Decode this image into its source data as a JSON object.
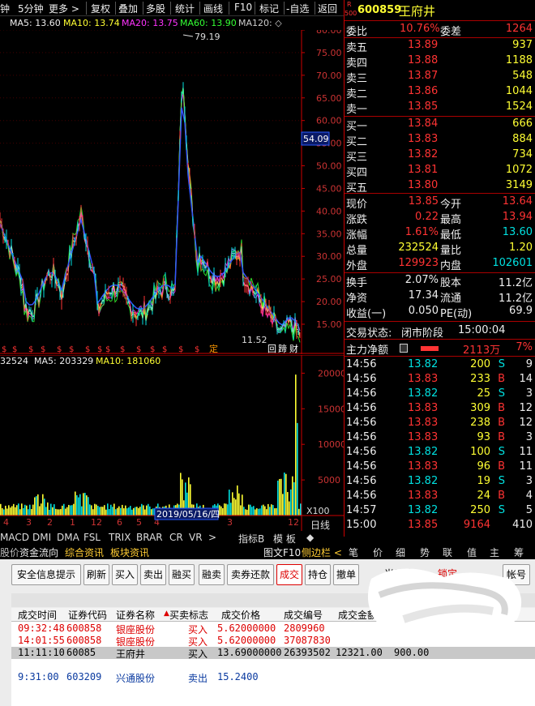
{
  "toolbar": {
    "period_left": "钟",
    "period": "5分钟",
    "more": "更多 >",
    "items": [
      "复权",
      "叠加",
      "多股",
      "统计",
      "画线",
      "F10",
      "标记",
      "-自选",
      "返回"
    ]
  },
  "ma_bar": {
    "ma5": "MA5: 13.60",
    "ma10": "MA10: 13.74",
    "ma20": "MA20: 13.75",
    "ma60": "MA60: 13.90",
    "ma120": "MA120: ◇"
  },
  "price_chart": {
    "y_ticks": [
      "80.00",
      "75.00",
      "70.00",
      "65.00",
      "60.00",
      "55.00",
      "50.00",
      "45.00",
      "40.00",
      "35.00",
      "30.00",
      "25.00",
      "20.00",
      "15.00"
    ],
    "current_tag": "54.09",
    "max_label": "79.19",
    "min_label": "11.52",
    "event_labels": [
      "定",
      "回",
      "蹄",
      "财"
    ]
  },
  "vol_bar": {
    "vol": "32524",
    "ma5": "MA5: 203329",
    "ma10": "MA10: 181060"
  },
  "vol_chart": {
    "y_ticks": [
      "20000",
      "15000",
      "10000",
      "5000"
    ],
    "unit": "X100",
    "date": "2019/05/16/四",
    "period": "日线",
    "x_ticks": [
      "4",
      "3",
      "2",
      "1",
      "12",
      "6",
      "5",
      "4",
      "3",
      "12"
    ]
  },
  "stock": {
    "code": "600859",
    "name": "王府井",
    "badge_r": "R",
    "badge_500": "500",
    "weibi_label": "委比",
    "weibi": "10.76%",
    "weicha_label": "委差",
    "weicha": "1264",
    "asks": [
      {
        "label": "卖五",
        "price": "13.89",
        "vol": "937"
      },
      {
        "label": "卖四",
        "price": "13.88",
        "vol": "1188"
      },
      {
        "label": "卖三",
        "price": "13.87",
        "vol": "548"
      },
      {
        "label": "卖二",
        "price": "13.86",
        "vol": "1044"
      },
      {
        "label": "卖一",
        "price": "13.85",
        "vol": "1524"
      }
    ],
    "bids": [
      {
        "label": "买一",
        "price": "13.84",
        "vol": "666"
      },
      {
        "label": "买二",
        "price": "13.83",
        "vol": "884"
      },
      {
        "label": "买三",
        "price": "13.82",
        "vol": "734"
      },
      {
        "label": "买四",
        "price": "13.81",
        "vol": "1072"
      },
      {
        "label": "买五",
        "price": "13.80",
        "vol": "3149"
      }
    ],
    "stats": [
      {
        "l1": "现价",
        "v1": "13.85",
        "l2": "今开",
        "v2": "13.64"
      },
      {
        "l1": "涨跌",
        "v1": "0.22",
        "l2": "最高",
        "v2": "13.94"
      },
      {
        "l1": "涨幅",
        "v1": "1.61%",
        "l2": "最低",
        "v2": "13.60"
      },
      {
        "l1": "总量",
        "v1": "232524",
        "l2": "量比",
        "v2": "1.20"
      },
      {
        "l1": "外盘",
        "v1": "129923",
        "l2": "内盘",
        "v2": "102601"
      }
    ],
    "stats2": [
      {
        "l1": "换手",
        "v1": "2.07%",
        "l2": "股本",
        "v2": "11.2亿"
      },
      {
        "l1": "净资",
        "v1": "17.34",
        "l2": "流通",
        "v2": "11.2亿"
      },
      {
        "l1": "收益(一)",
        "v1": "0.050",
        "l2": "PE(动)",
        "v2": "69.9"
      }
    ],
    "status_label": "交易状态:",
    "status_value": "闭市阶段",
    "status_time": "15:00:04",
    "main_flow_label": "主力净额",
    "main_flow_value": "2113万",
    "main_flow_pct": "7%"
  },
  "ticks": [
    {
      "t": "14:56",
      "p": "13.82",
      "v": "200",
      "d": "S",
      "n": "9"
    },
    {
      "t": "14:56",
      "p": "13.83",
      "v": "233",
      "d": "B",
      "n": "14"
    },
    {
      "t": "14:56",
      "p": "13.82",
      "v": "25",
      "d": "S",
      "n": "3"
    },
    {
      "t": "14:56",
      "p": "13.83",
      "v": "309",
      "d": "B",
      "n": "12"
    },
    {
      "t": "14:56",
      "p": "13.83",
      "v": "238",
      "d": "B",
      "n": "12"
    },
    {
      "t": "14:56",
      "p": "13.83",
      "v": "93",
      "d": "B",
      "n": "3"
    },
    {
      "t": "14:56",
      "p": "13.82",
      "v": "100",
      "d": "S",
      "n": "11"
    },
    {
      "t": "14:56",
      "p": "13.83",
      "v": "96",
      "d": "B",
      "n": "11"
    },
    {
      "t": "14:56",
      "p": "13.82",
      "v": "19",
      "d": "S",
      "n": "3"
    },
    {
      "t": "14:56",
      "p": "13.83",
      "v": "24",
      "d": "B",
      "n": "4"
    },
    {
      "t": "14:57",
      "p": "13.82",
      "v": "250",
      "d": "S",
      "n": "5"
    },
    {
      "t": "15:00",
      "p": "13.85",
      "v": "9164",
      "d": "",
      "n": "410"
    }
  ],
  "tabs1": [
    "MACD",
    "DMI",
    "DMA",
    "FSL",
    "TRIX",
    "BRAR",
    "CR",
    "VR",
    ">",
    "指标B",
    "模 板",
    "◆"
  ],
  "tabs2": [
    "资金流向",
    "综合资讯",
    "板块资讯",
    "图文F10",
    "侧边栏 <"
  ],
  "tabs2_left": "股价",
  "ntabs": [
    "笔",
    "价",
    "细",
    "势",
    "联",
    "值",
    "主",
    "筹"
  ],
  "trade_buttons": [
    "安全信息提示",
    "刷新",
    "买入",
    "卖出",
    "融买",
    "融卖",
    "卖券还款",
    "成交",
    "持仓",
    "撤单",
    "当日成"
  ],
  "trade_right": {
    "lock": "锁定",
    "account": "帐号"
  },
  "grid": {
    "headers": [
      "成交时间",
      "证券代码",
      "证券名称",
      "买卖标志",
      "成交价格",
      "成交编号",
      "成交金额"
    ],
    "rows": [
      {
        "time": "09:32:48",
        "code": "600858",
        "name": "银座股份",
        "side": "买入",
        "price": "5.62000000",
        "no": "2809960",
        "amt": "",
        "extra": ""
      },
      {
        "time": "14:01:55",
        "code": "600858",
        "name": "银座股份",
        "side": "买入",
        "price": "5.62000000",
        "no": "37087830",
        "amt": "",
        "extra": ""
      },
      {
        "time": "11:11:10",
        "code": "60085",
        "name": "王府井",
        "side": "买入",
        "price": "13.69000000",
        "no": "26393502",
        "amt": "12321.00",
        "extra": "900.00"
      },
      {
        "time": "",
        "code": "",
        "name": "",
        "side": "",
        "price": "",
        "no": "",
        "amt": "",
        "extra": ""
      },
      {
        "time": "9:31:00",
        "code": "603209",
        "name": "兴通股份",
        "side": "卖出",
        "price": "15.2400",
        "no": "",
        "amt": "",
        "extra": ""
      }
    ]
  },
  "colors": {
    "up": "#ff3333",
    "down": "#00e0e0",
    "volume": "#ffff33",
    "ma10": "#ffff33",
    "ma20": "#ff33ff",
    "ma60": "#33ff33",
    "ma120": "#3355ff"
  }
}
